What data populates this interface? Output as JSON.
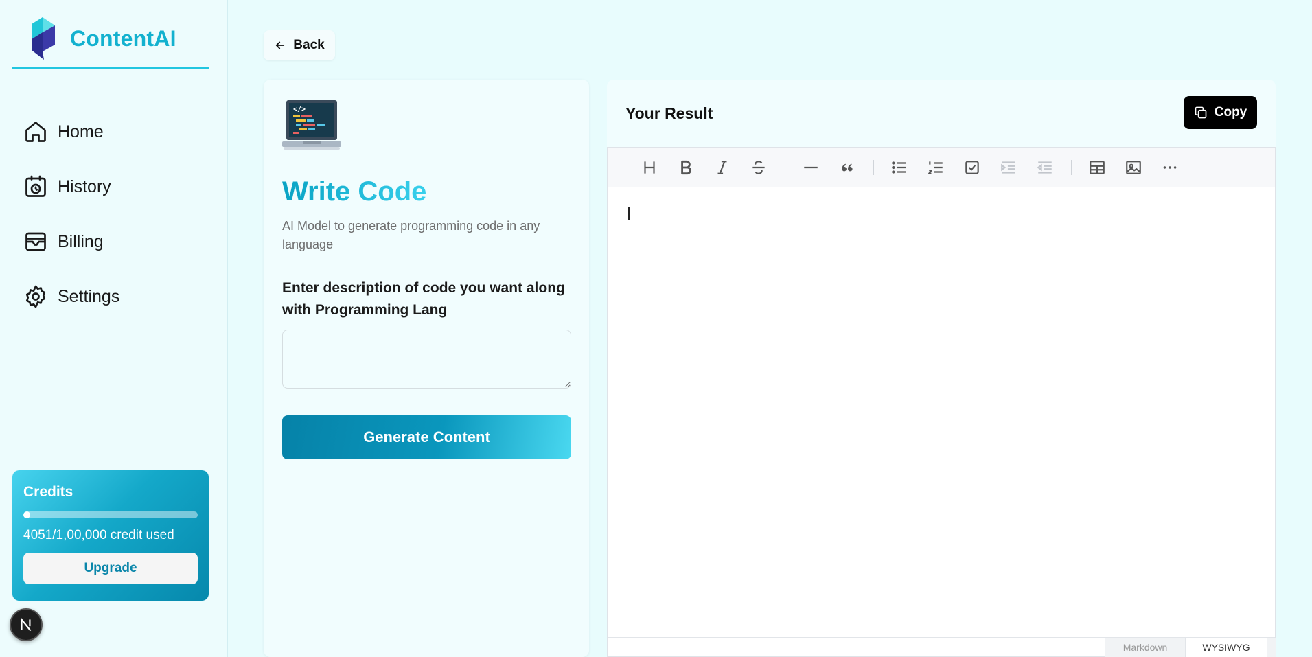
{
  "brand": {
    "name": "ContentAI"
  },
  "nav": [
    {
      "label": "Home",
      "icon": "home-icon"
    },
    {
      "label": "History",
      "icon": "history-icon"
    },
    {
      "label": "Billing",
      "icon": "billing-icon"
    },
    {
      "label": "Settings",
      "icon": "settings-icon"
    }
  ],
  "credits": {
    "title": "Credits",
    "used_text": "4051/1,00,000 credit used",
    "used_fraction": 0.04051,
    "upgrade_label": "Upgrade"
  },
  "back_label": "Back",
  "tool": {
    "title": "Write Code",
    "description": "AI Model to generate programming code in any language",
    "field_label": "Enter description of code you want along with Programming Lang",
    "field_value": "",
    "generate_label": "Generate Content"
  },
  "result": {
    "title": "Your Result",
    "copy_label": "Copy",
    "toolbar": [
      "heading-icon",
      "bold-icon",
      "italic-icon",
      "strike-icon",
      "hr-icon",
      "quote-icon",
      "bullet-list-icon",
      "ordered-list-icon",
      "task-list-icon",
      "indent-icon",
      "outdent-icon",
      "table-icon",
      "image-icon",
      "more-icon"
    ],
    "modes": {
      "markdown": "Markdown",
      "wysiwyg": "WYSIWYG"
    }
  },
  "colors": {
    "brand": "#13b1cf",
    "accent_dark": "#0682a8",
    "copy_bg": "#000000"
  }
}
